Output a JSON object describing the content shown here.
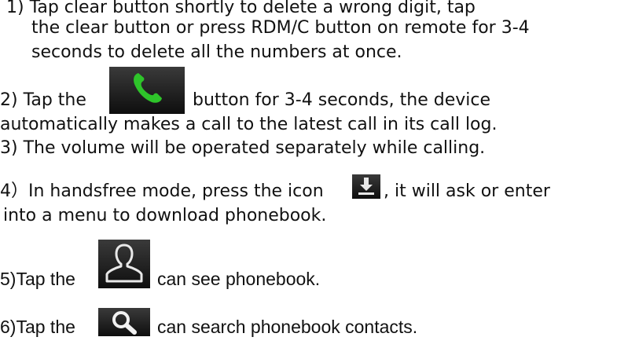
{
  "items": [
    {
      "id": "1",
      "lines": [
        "1)  Tap clear button shortly to delete a wrong digit, tap",
        "the clear button or press RDM/C button on remote for 3-4",
        "seconds to delete all the numbers at once."
      ]
    },
    {
      "id": "2",
      "before_icon": "2) Tap the",
      "after_icon": "button for 3-4 seconds, the device",
      "line2": "automatically makes a call to the latest call in its call log.",
      "icon": "phone-call-icon"
    },
    {
      "id": "3",
      "text": "3)  The volume will be operated separately while calling."
    },
    {
      "id": "4",
      "before_icon": "4）In handsfree mode, press the icon",
      "after_icon": ", it will ask or enter",
      "line2": "into a menu to download phonebook.",
      "icon": "download-icon"
    },
    {
      "id": "5",
      "before_icon": "5)Tap the",
      "after_icon": "can see phonebook.",
      "icon": "contact-person-icon"
    },
    {
      "id": "6",
      "before_icon": "6)Tap the",
      "after_icon": "can search phonebook contacts.",
      "icon": "search-magnifier-icon"
    }
  ],
  "colors": {
    "icon_bg": "#1a1a1a",
    "phone_green": "#2ec42a",
    "icon_light": "#e8e8e8"
  }
}
